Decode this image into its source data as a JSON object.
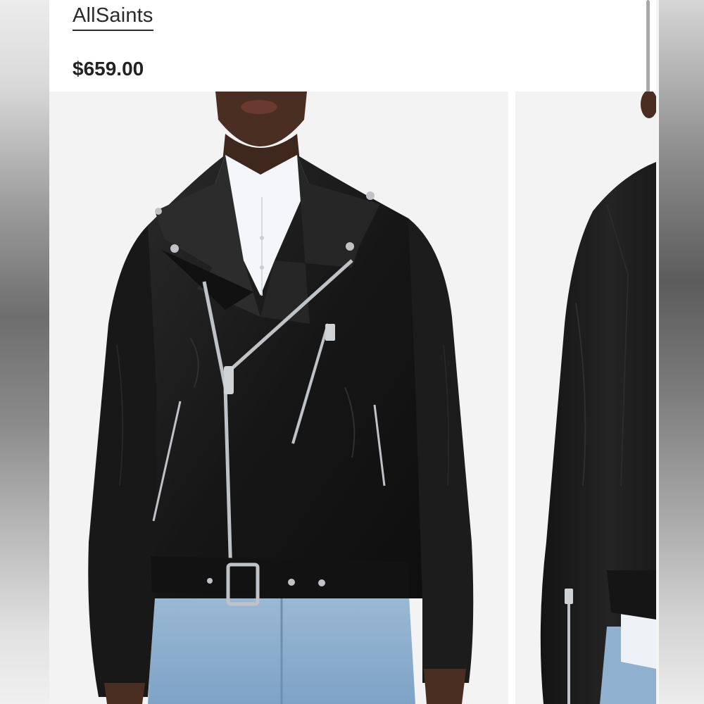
{
  "product": {
    "brand": "AllSaints",
    "price": "$659.00"
  },
  "gallery": {
    "images": [
      {
        "alt": "front-view"
      },
      {
        "alt": "side-view"
      }
    ]
  },
  "colors": {
    "jacket": "#1b1b1b",
    "denim": "#8fb0cf",
    "shirt": "#f4f6fa",
    "skin": "#4a2e22",
    "background": "#f3f3f3",
    "hardware": "#bfc3c7"
  }
}
